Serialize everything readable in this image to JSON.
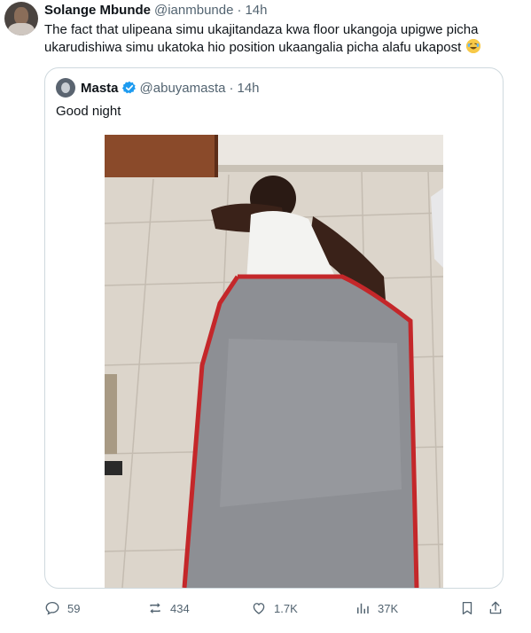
{
  "tweet": {
    "author_name": "Solange Mbunde",
    "author_handle": "@ianmbunde",
    "separator": "·",
    "time": "14h",
    "text": "The fact that ulipeana simu ukajitandaza kwa floor ukangoja upigwe picha ukarudishiwa simu ukatoka hio position ukaangalia picha alafu ukapost",
    "emoji": "rolling-on-floor-laughing-emoji"
  },
  "quoted": {
    "author_name": "Masta",
    "author_handle": "@abuyamasta",
    "separator": "·",
    "time": "14h",
    "text": "Good night",
    "verified_color": "#1d9bf0"
  },
  "actions": {
    "replies": "59",
    "retweets": "434",
    "likes": "1.7K",
    "views": "37K"
  },
  "colors": {
    "text": "#0f1419",
    "secondary": "#536471",
    "border": "#cfd9de"
  }
}
